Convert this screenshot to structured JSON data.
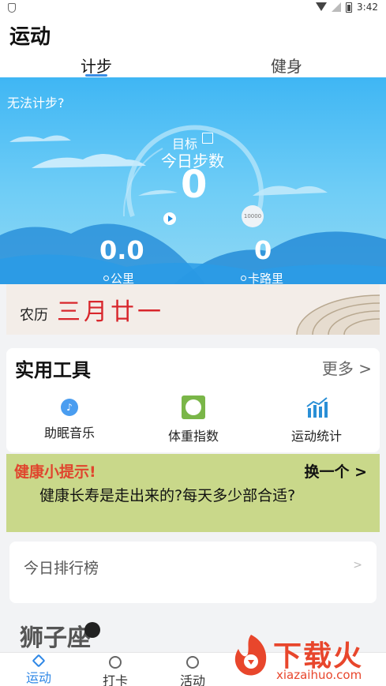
{
  "status_bar": {
    "time": "3:42"
  },
  "header": {
    "title": "运动"
  },
  "tabs": [
    {
      "label": "计步"
    },
    {
      "label": "健身"
    }
  ],
  "pedometer": {
    "cant_count": "无法计步?",
    "goal_label": "目标",
    "steps_label": "今日步数",
    "steps_value": "0",
    "goal_value": "10000",
    "distance_value": "0.0",
    "distance_unit": "公里",
    "calories_value": "0",
    "calories_unit": "卡路里"
  },
  "lunar": {
    "label": "农历",
    "date": "三月廿一"
  },
  "tools": {
    "title": "实用工具",
    "more": "更多 >",
    "items": [
      {
        "label": "助眠音乐",
        "icon": "music-note-icon"
      },
      {
        "label": "体重指数",
        "icon": "scale-icon"
      },
      {
        "label": "运动统计",
        "icon": "bar-chart-icon"
      }
    ]
  },
  "tips": {
    "title": "健康小提示!",
    "swap": "换一个 >",
    "text": "健康长寿是走出来的?每天多少部合适?"
  },
  "ranking": {
    "label": "今日排行榜",
    "chevron": ">"
  },
  "horoscope": {
    "sign": "狮子座"
  },
  "bottom_nav": [
    {
      "label": "运动",
      "active": true
    },
    {
      "label": "打卡",
      "active": false
    },
    {
      "label": "活动",
      "active": false
    }
  ],
  "watermark": {
    "brand": "下载火",
    "url": "xiazaihuo.com"
  },
  "colors": {
    "accent": "#2e87e6",
    "sky": "#3fb6f4",
    "lunar_red": "#d8262c",
    "tip_red": "#e0452e"
  }
}
